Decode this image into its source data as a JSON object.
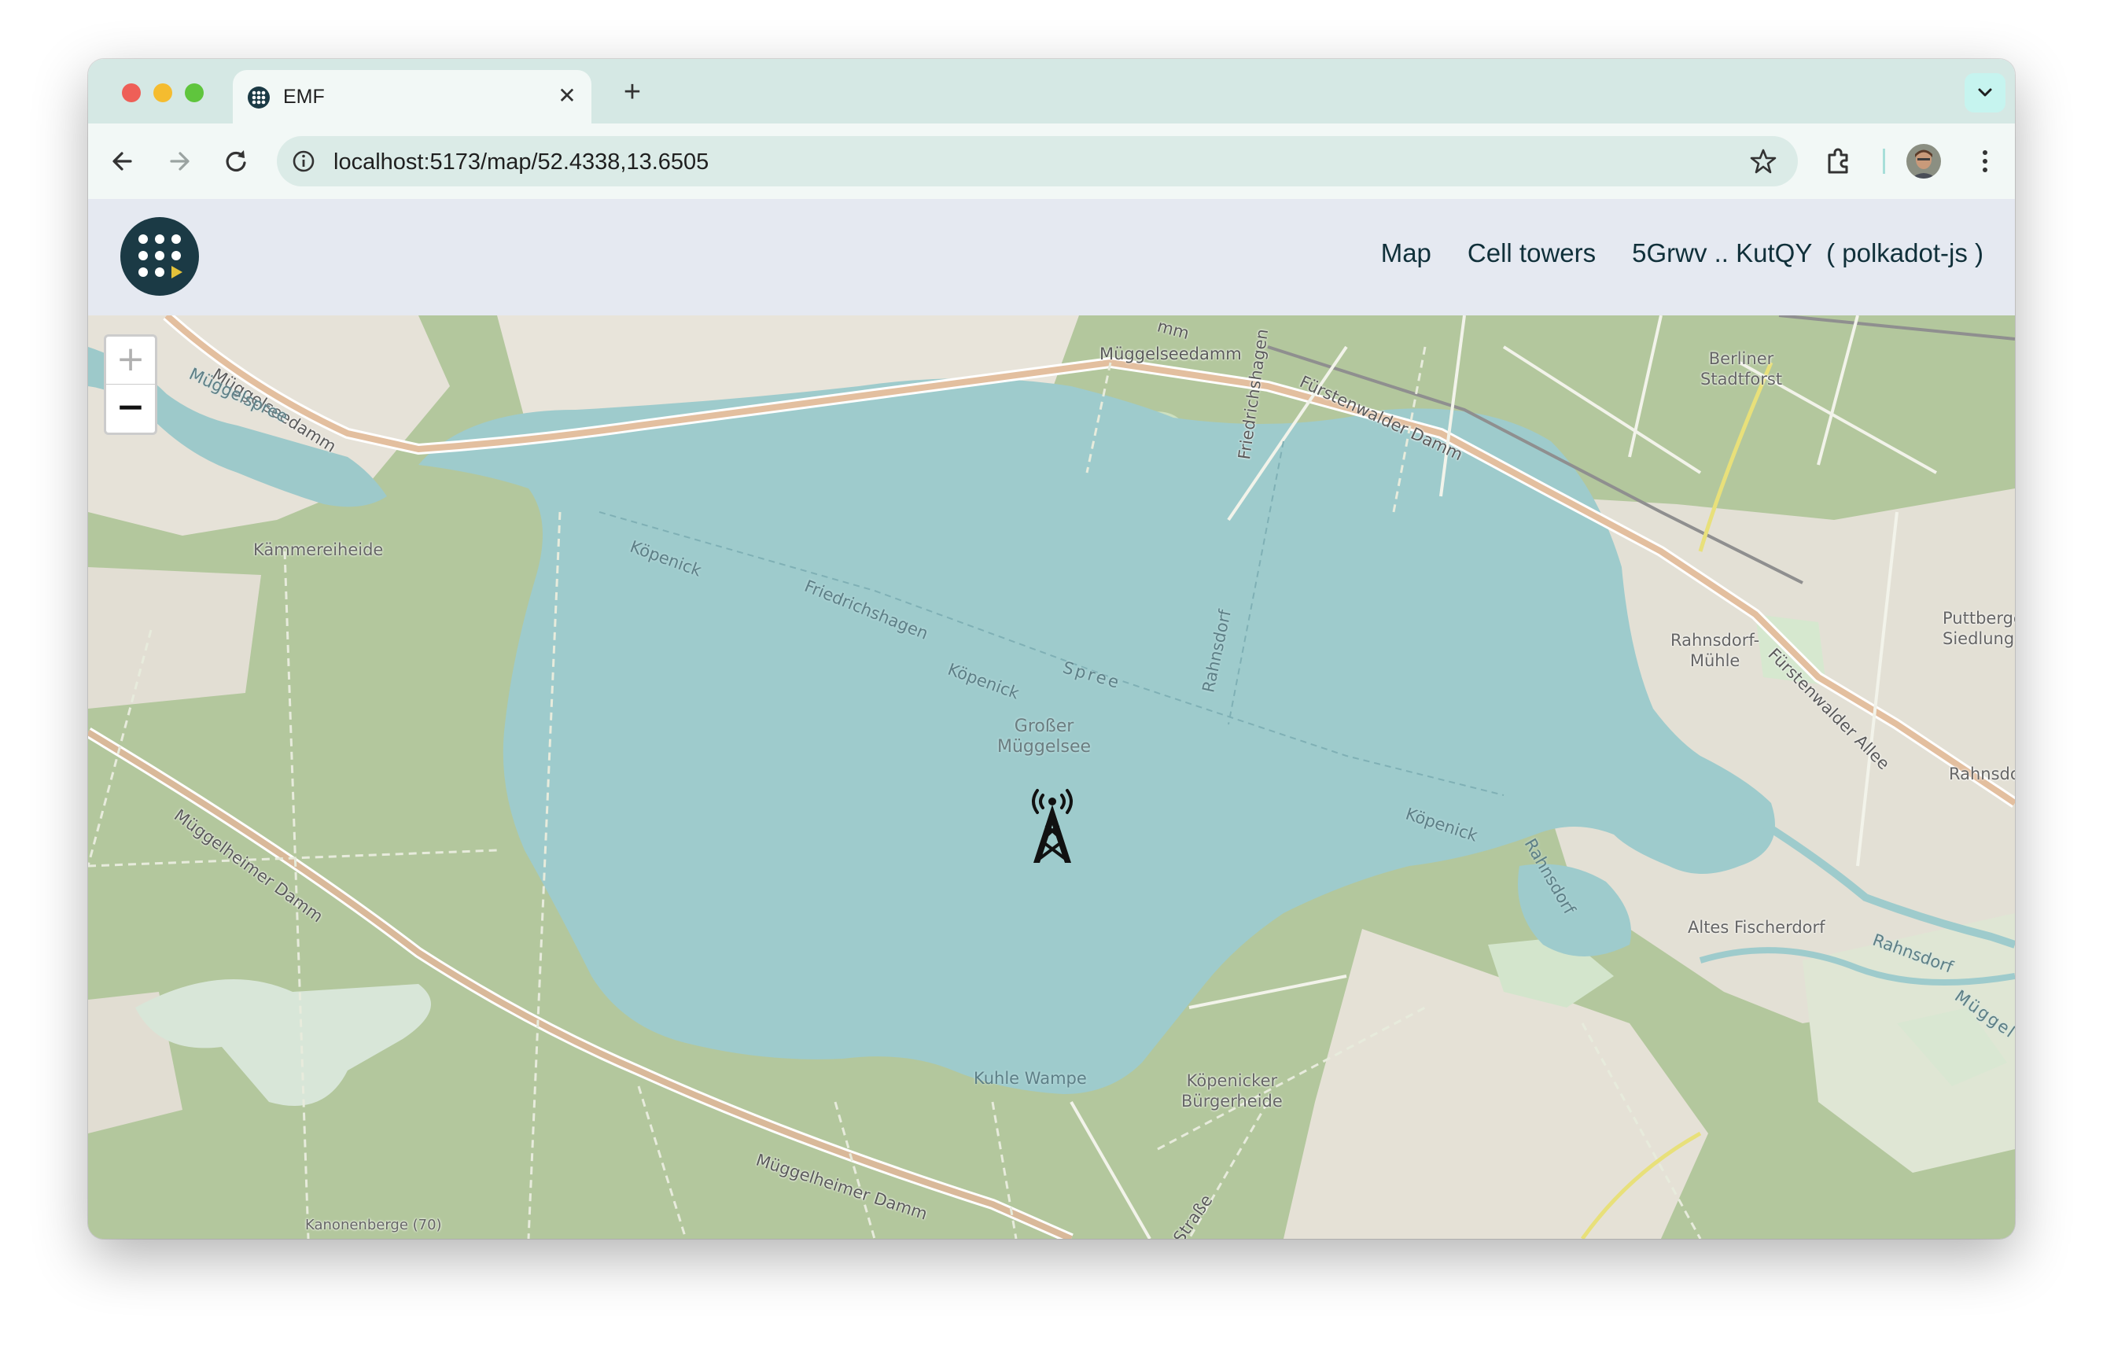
{
  "browser": {
    "tab": {
      "title": "EMF",
      "close_glyph": "✕",
      "favicon": "globe-icon"
    },
    "new_tab_glyph": "+",
    "url": "localhost:5173/map/52.4338,13.6505",
    "icons": [
      "back-arrow-icon",
      "forward-arrow-icon",
      "reload-icon",
      "site-info-icon",
      "bookmark-star-icon",
      "extensions-icon",
      "profile-avatar",
      "more-menu-icon",
      "tab-search-chevron-icon"
    ]
  },
  "app": {
    "nav": {
      "map": "Map",
      "cell_towers": "Cell towers",
      "account": "5Grwv .. KutQY  ( polkadot-js )"
    },
    "colors": {
      "header_bg": "#e5e9f1",
      "logo_bg": "#1b3a45",
      "logo_accent": "#e3c23a"
    }
  },
  "map": {
    "zoom_in": "+",
    "zoom_out": "−",
    "marker": "cell-tower-icon",
    "labels": {
      "lake": "Großer\nMüggelsee",
      "kuhle_wampe": "Kuhle Wampe",
      "kammereiheide": "Kämmereiheide",
      "berliner_stadtforst": "Berliner\nStadtforst",
      "rahnsdorf_muhle": "Rahnsdorf-\nMühle",
      "puttberge": "Puttberge\nSiedlung",
      "rahnsdo": "Rahnsdo",
      "altes_fischerdorf": "Altes Fischerdorf",
      "kopenicker_burgerheide": "Köpenicker\nBürgerheide",
      "kanonenberge": "Kanonenberge (70)",
      "muggelseedamm_left": "Müggelseedamm",
      "muggelspree": "Müggelspree",
      "muggelseedamm_top": "Müggelseedamm",
      "friedrichshagen_road": "Friedrichshagen",
      "furstenwalder_damm": "Fürstenwalder Damm",
      "furstenwalder_allee": "Fürstenwalder Allee",
      "muggelheimer_damm_left": "Müggelheimer Damm",
      "muggelheimer_damm_bottom": "Müggelheimer Damm",
      "kopenick_1": "Köpenick",
      "friedrichshagen_ferry": "Friedrichshagen",
      "kopenick_2": "Köpenick",
      "spree": "Spree",
      "rahnsdorf_ferry": "Rahnsdorf",
      "kopenick_3": "Köpenick",
      "rahnsdorf_canal": "Rahnsdorf",
      "rahnsdorf_east": "Rahnsdorf",
      "muggel_east": "Müggel",
      "strasse": "Straße",
      "damm_top": "mm"
    }
  }
}
